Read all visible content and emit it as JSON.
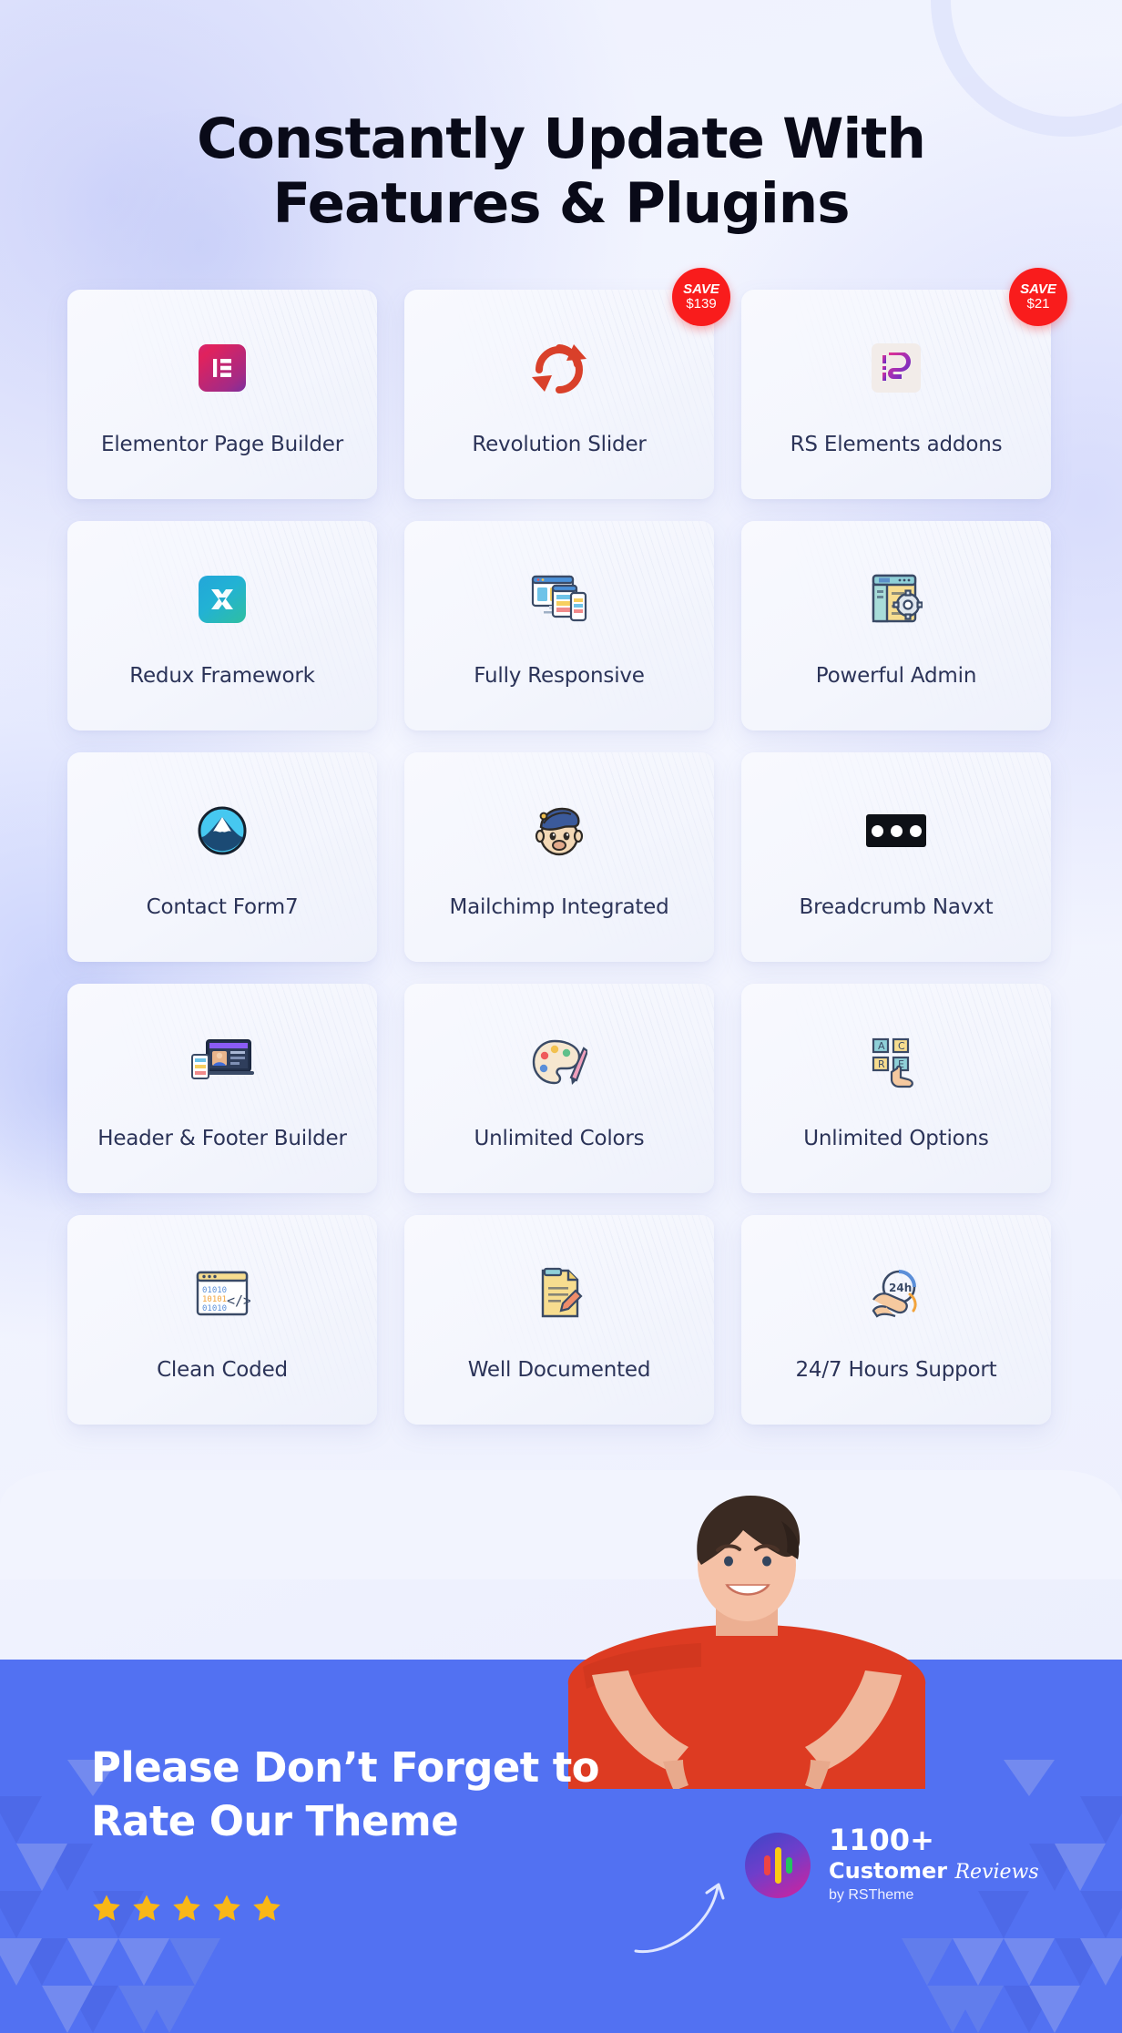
{
  "heading": {
    "line1": "Constantly Update With",
    "line2": "Features & Plugins"
  },
  "colors": {
    "page_bg": "#eef0fd",
    "card_bg": "#f6f8fd",
    "label": "#2b3358",
    "badge_red": "#f91c1c",
    "cta_blue": "#5271f2",
    "star_gold": "#f9b717"
  },
  "features": [
    {
      "label": "Elementor Page Builder",
      "icon": "elementor-icon",
      "badge": null
    },
    {
      "label": "Revolution Slider",
      "icon": "revolution-slider-icon",
      "badge": {
        "line1": "SAVE",
        "line2": "$139"
      }
    },
    {
      "label": "RS Elements addons",
      "icon": "rs-elements-icon",
      "badge": {
        "line1": "SAVE",
        "line2": "$21"
      }
    },
    {
      "label": "Redux Framework",
      "icon": "redux-framework-icon",
      "badge": null
    },
    {
      "label": "Fully Responsive",
      "icon": "responsive-devices-icon",
      "badge": null
    },
    {
      "label": "Powerful Admin",
      "icon": "admin-panel-gear-icon",
      "badge": null
    },
    {
      "label": "Contact Form7",
      "icon": "contact-form7-icon",
      "badge": null
    },
    {
      "label": "Mailchimp Integrated",
      "icon": "mailchimp-monkey-icon",
      "badge": null
    },
    {
      "label": "Breadcrumb Navxt",
      "icon": "breadcrumb-dots-icon",
      "badge": null
    },
    {
      "label": "Header & Footer Builder",
      "icon": "header-footer-builder-icon",
      "badge": null
    },
    {
      "label": "Unlimited Colors",
      "icon": "color-palette-icon",
      "badge": null
    },
    {
      "label": "Unlimited Options",
      "icon": "options-click-icon",
      "badge": null
    },
    {
      "label": "Clean Coded",
      "icon": "code-window-icon",
      "badge": null
    },
    {
      "label": "Well Documented",
      "icon": "document-icon",
      "badge": null
    },
    {
      "label": "24/7 Hours Support",
      "icon": "support-24h-icon",
      "badge": null
    }
  ],
  "cta": {
    "title_line1": "Please Don’t Forget to",
    "title_line2": "Rate Our Theme",
    "star_count": 5,
    "reviews": {
      "count": "1100+",
      "label_bold": "Customer",
      "label_script": "Reviews",
      "byline": "by RSTheme"
    }
  }
}
